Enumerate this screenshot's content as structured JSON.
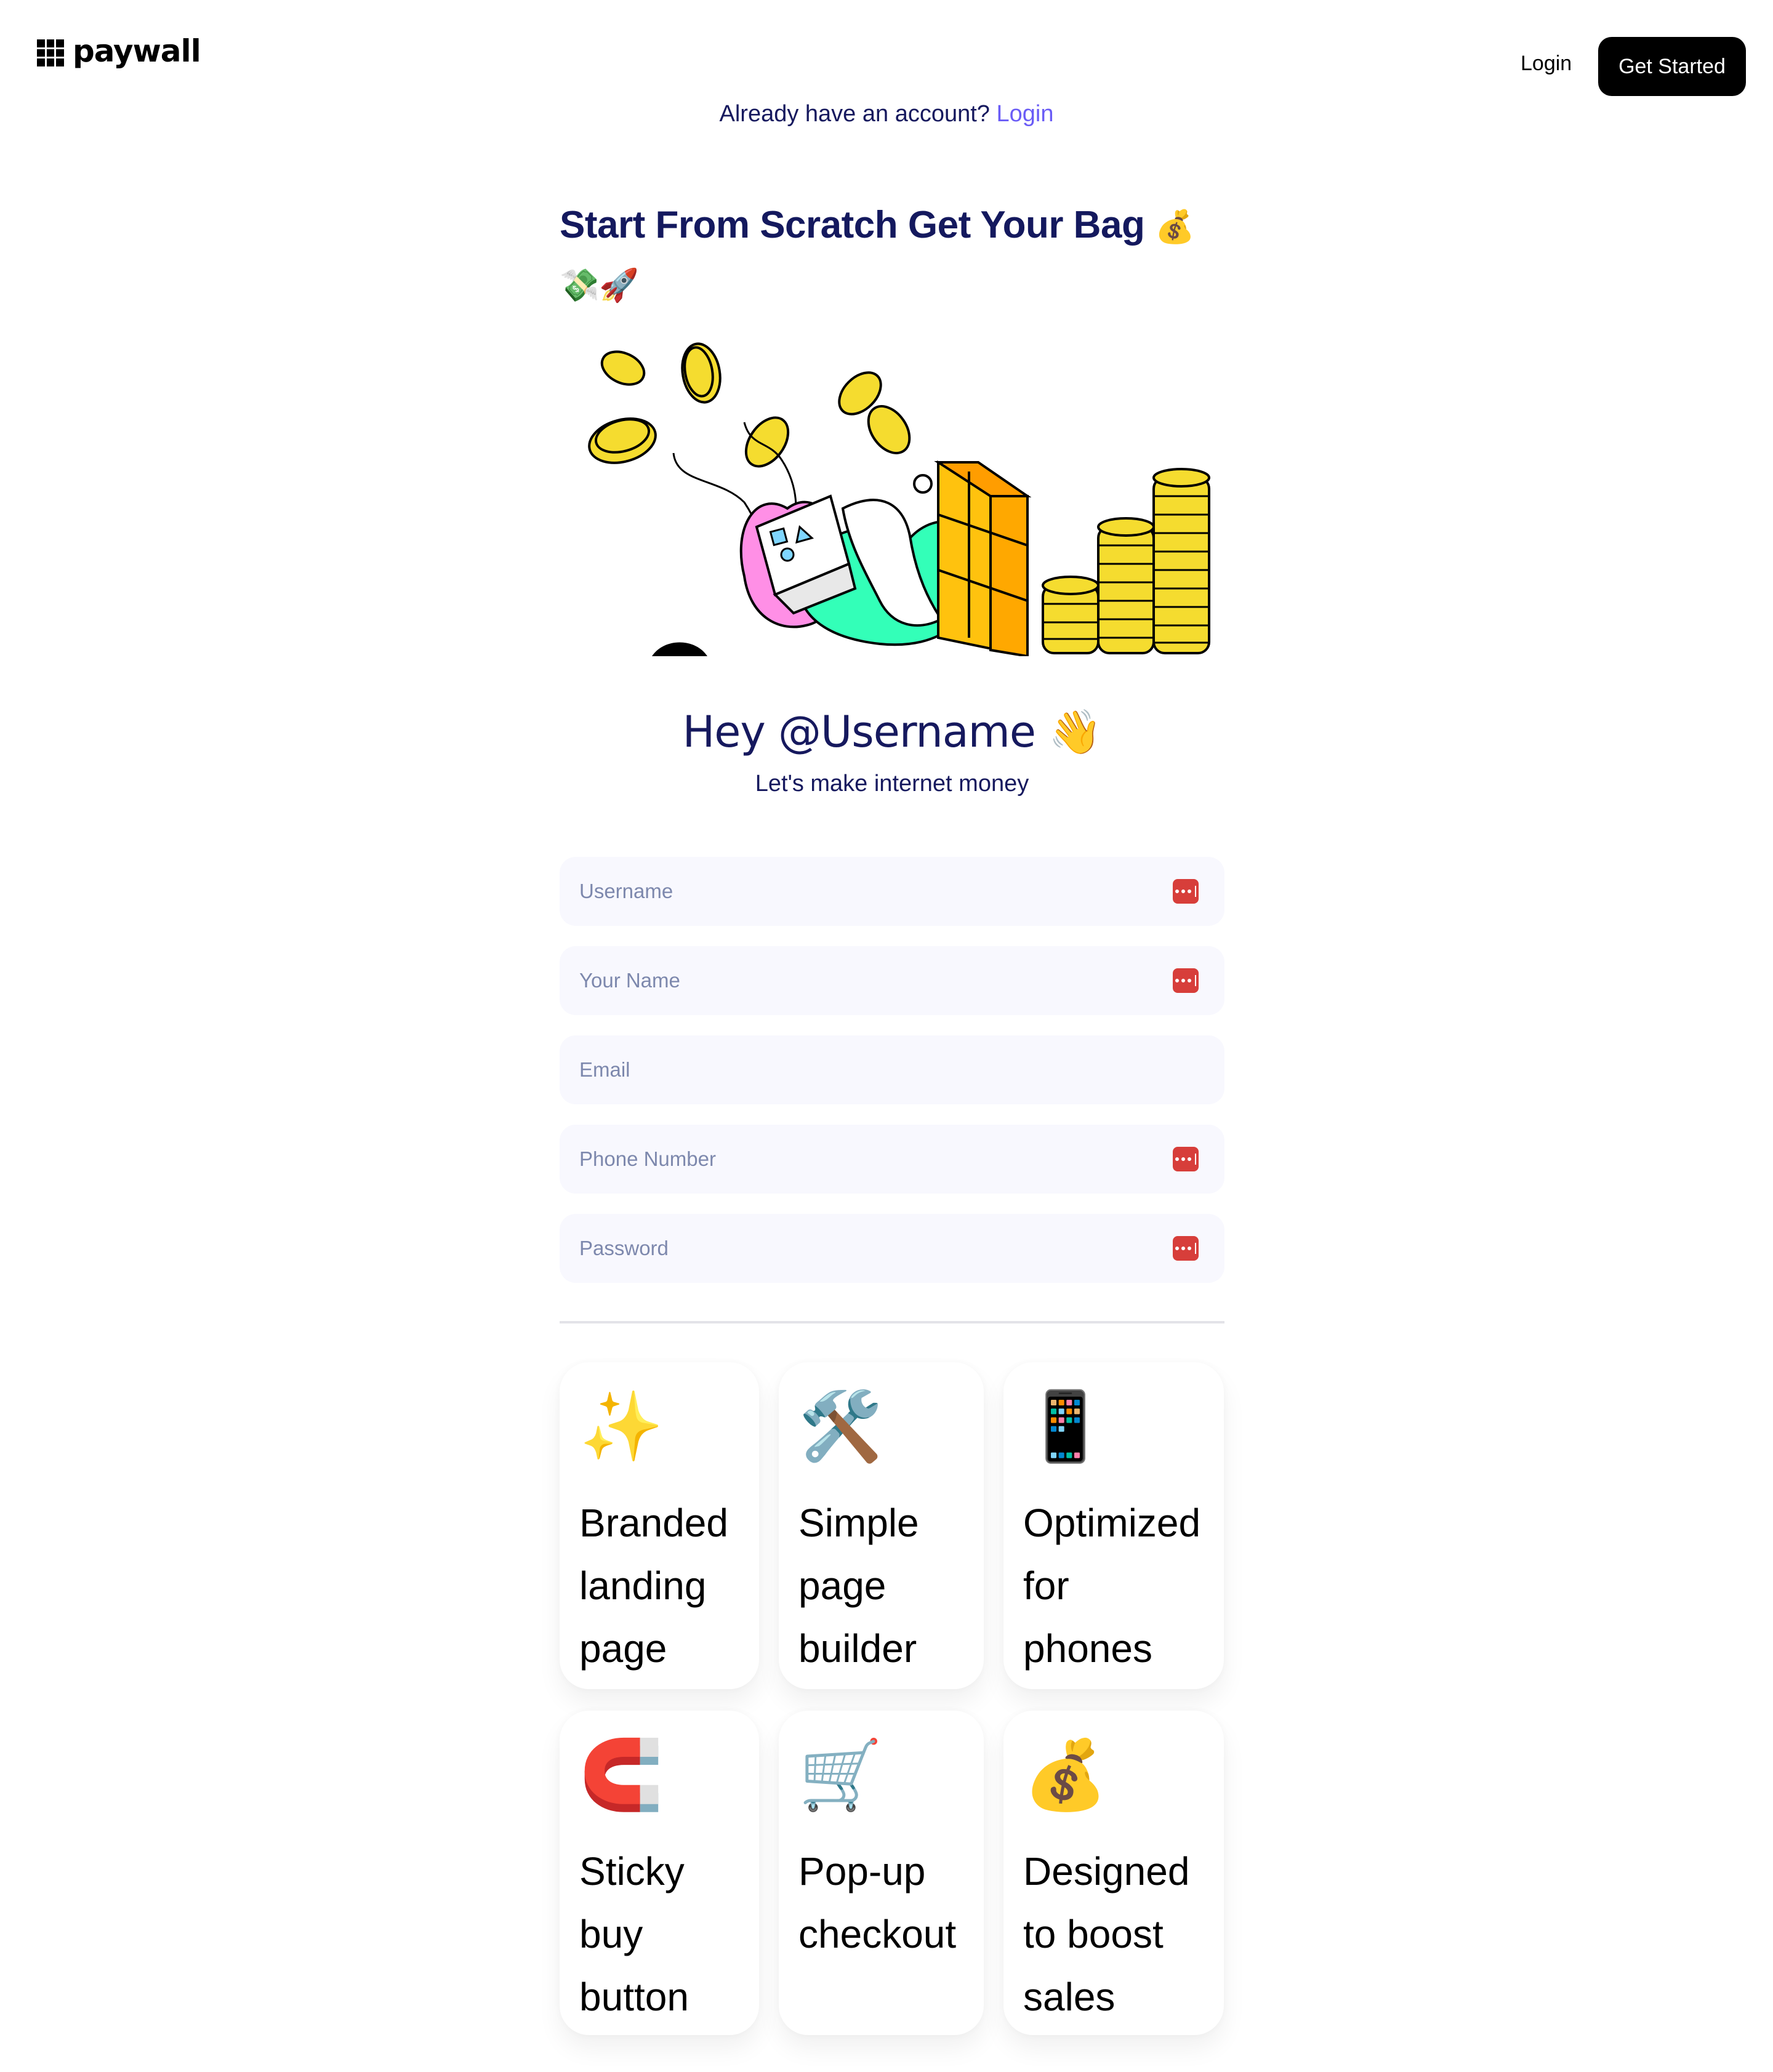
{
  "header": {
    "logo_text": "paywall",
    "login_label": "Login",
    "cta_label": "Get Started"
  },
  "account_prompt": {
    "text": "Already have an account?",
    "link_label": "Login",
    "link_color": "#6a5cf6"
  },
  "headline": {
    "text": "Start From Scratch Get Your Bag",
    "emoji_1": "💰",
    "emoji_2": "💸🚀"
  },
  "illustration": {
    "description": "person-with-card-coins-and-wall-illustration"
  },
  "greeting": {
    "title": "Hey @Username",
    "title_emoji": "👋",
    "subtitle": "Let's make internet money"
  },
  "form": {
    "fields": [
      {
        "placeholder": "Username",
        "value": "",
        "type": "text",
        "password_manager_icon": true
      },
      {
        "placeholder": "Your Name",
        "value": "",
        "type": "text",
        "password_manager_icon": true
      },
      {
        "placeholder": "Email",
        "value": "",
        "type": "email",
        "password_manager_icon": false
      },
      {
        "placeholder": "Phone Number",
        "value": "",
        "type": "tel",
        "password_manager_icon": true
      },
      {
        "placeholder": "Password",
        "value": "",
        "type": "password",
        "password_manager_icon": true
      }
    ],
    "password_manager_icon_color": "#d73e3a"
  },
  "features": [
    {
      "icon": "sparkles-icon",
      "emoji": "✨",
      "title": "Branded landing page"
    },
    {
      "icon": "hammer-wrench-icon",
      "emoji": "🛠️",
      "title": "Simple page builder"
    },
    {
      "icon": "mobile-phone-icon",
      "emoji": "📱",
      "title": "Optimized for phones"
    },
    {
      "icon": "magnet-icon",
      "emoji": "🧲",
      "title": "Sticky buy button"
    },
    {
      "icon": "shopping-cart-icon",
      "emoji": "🛒",
      "title": "Pop-up checkout"
    },
    {
      "icon": "money-bag-icon",
      "emoji": "💰",
      "title": "Designed to boost sales"
    }
  ],
  "colors": {
    "navy_text": "#16195e",
    "field_bg": "#f8f8fe",
    "placeholder": "#7d88ad",
    "cta_bg": "#000000"
  }
}
